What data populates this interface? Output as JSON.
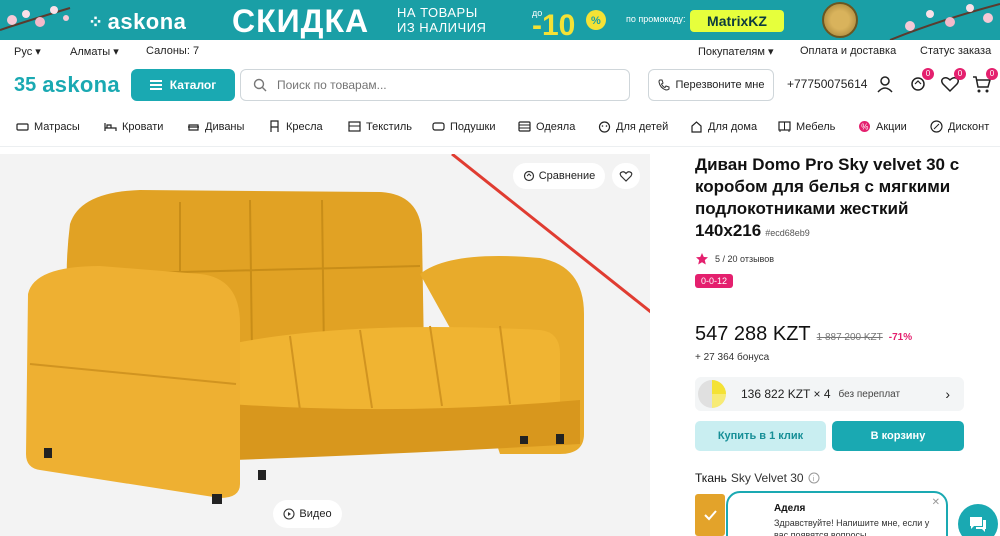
{
  "promo": {
    "brand": "askona",
    "headline": "СКИДКА",
    "sub_line1": "НА ТОВАРЫ",
    "sub_line2": "ИЗ НАЛИЧИЯ",
    "discount_prefix": "до",
    "discount_value": "-10",
    "discount_unit": "%",
    "code_label": "по промокоду:",
    "code": "MatrixKZ"
  },
  "util": {
    "lang": "Рус",
    "city": "Алматы",
    "salons": "Салоны: 7",
    "buyers": "Покупателям",
    "payment": "Оплата и доставка",
    "order_status": "Статус заказа"
  },
  "header": {
    "logo_num": "35",
    "logo_name": "askona",
    "catalog": "Каталог",
    "search_placeholder": "Поиск по товарам...",
    "callback": "Перезвоните мне",
    "phone": "+77750075614",
    "compare_count": "0",
    "fav_count": "0",
    "cart_count": "0"
  },
  "categories": [
    {
      "label": "Матрасы",
      "icon": "mattress-icon"
    },
    {
      "label": "Кровати",
      "icon": "bed-icon"
    },
    {
      "label": "Диваны",
      "icon": "sofa-icon"
    },
    {
      "label": "Кресла",
      "icon": "chair-icon"
    },
    {
      "label": "Текстиль",
      "icon": "textile-icon"
    },
    {
      "label": "Подушки",
      "icon": "pillow-icon"
    },
    {
      "label": "Одеяла",
      "icon": "blanket-icon"
    },
    {
      "label": "Для детей",
      "icon": "kids-icon"
    },
    {
      "label": "Для дома",
      "icon": "home-icon"
    },
    {
      "label": "Мебель",
      "icon": "furniture-icon"
    },
    {
      "label": "Акции",
      "icon": "sale-icon"
    },
    {
      "label": "Дисконт",
      "icon": "discount-icon"
    }
  ],
  "gallery": {
    "compare": "Сравнение",
    "video": "Видео"
  },
  "product": {
    "title": "Диван Domo Pro Sky velvet 30 с коробом для белья с мягкими подлокотниками жесткий 140x216",
    "sku": "#ecd68eb9",
    "rating": "5 / 20 отзывов",
    "tag": "0-0-12",
    "price": "547 288 KZT",
    "old_price": "1 887 200 KZT",
    "discount": "-71%",
    "bonus": "+ 27 364 бонуса",
    "installment_amount": "136 822 KZT × 4",
    "installment_note": "без переплат",
    "buy_one_click": "Купить в 1 клик",
    "add_to_cart": "В корзину",
    "fabric_label": "Ткань",
    "fabric_value": "Sky Velvet 30",
    "swatch_color": "#e3a32a"
  },
  "chat": {
    "name": "Аделя",
    "message": "Здравствуйте! Напишите мне, если у вас появятся вопросы."
  },
  "colors": {
    "accent": "#1aa9b2",
    "pink": "#e4206e",
    "sofa": "#e3a32a"
  }
}
